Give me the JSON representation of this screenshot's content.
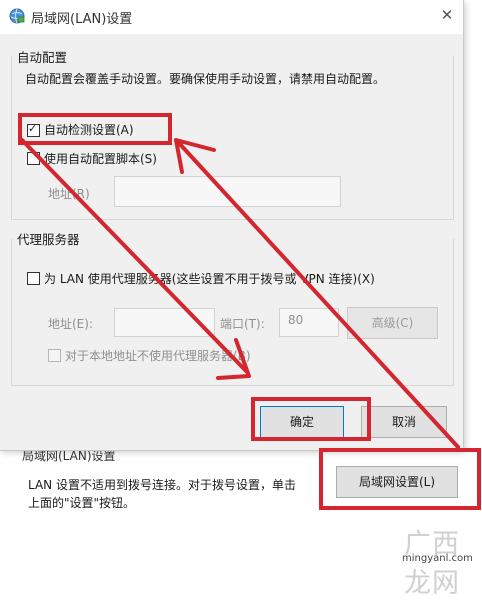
{
  "dialog": {
    "title": "局域网(LAN)设置",
    "close_glyph": "✕",
    "auto_config": {
      "section_label": "自动配置",
      "description": "自动配置会覆盖手动设置。要确保使用手动设置，请禁用自动配置。",
      "auto_detect_label": "自动检测设置(A)",
      "auto_detect_checked": true,
      "use_script_label": "使用自动配置脚本(S)",
      "use_script_checked": false,
      "address_label": "地址(R)",
      "address_value": ""
    },
    "proxy": {
      "section_label": "代理服务器",
      "use_proxy_label": "为 LAN 使用代理服务器(这些设置不用于拨号或 VPN 连接)(X)",
      "use_proxy_checked": false,
      "address_label": "地址(E):",
      "address_value": "",
      "port_label": "端口(T):",
      "port_value": "80",
      "advanced_button": "高级(C)",
      "bypass_label": "对于本地地址不使用代理服务器(B)",
      "bypass_checked": false
    },
    "ok_button": "确定",
    "cancel_button": "取消"
  },
  "background": {
    "section_label": "局域网(LAN)设置",
    "description_line1": "LAN 设置不适用到拨号连接。对于拨号设置，单击",
    "description_line2": "上面的\"设置\"按钮。",
    "lan_settings_button": "局域网设置(L)"
  },
  "watermark": {
    "logo_text": "广西龙网",
    "url": "mingyanl.com"
  },
  "colors": {
    "annotation_red": "#d3262f",
    "dialog_bg": "#f0f0f0",
    "button_bg": "#e1e1e1"
  },
  "icons": {
    "title_icon": "globe-network-icon",
    "close": "close-icon",
    "check": "checkmark-icon"
  }
}
